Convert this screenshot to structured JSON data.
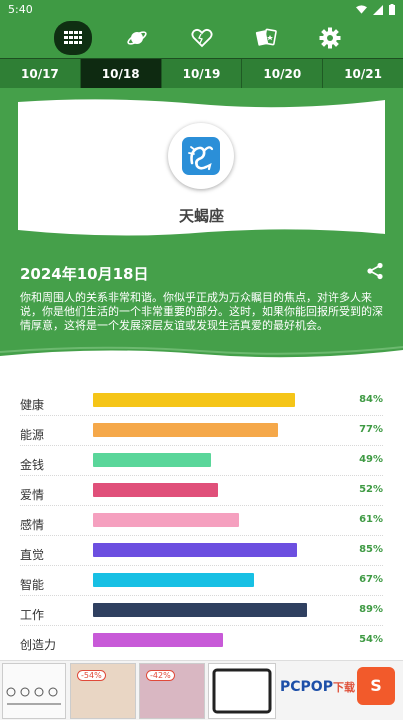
{
  "status": {
    "time": "5:40"
  },
  "nav": {
    "icons": [
      "grid-icon",
      "planet-icon",
      "heart-icon",
      "cards-icon",
      "gear-icon"
    ],
    "active_index": 0
  },
  "date_tabs": [
    "10/17",
    "10/18",
    "10/19",
    "10/20",
    "10/21"
  ],
  "selected_tab": 1,
  "sign": {
    "name": "天蝎座",
    "icon": "scorpio-icon"
  },
  "reading": {
    "date_title": "2024年10月18日",
    "text": "你和周围人的关系非常和谐。你似乎正成为万众瞩目的焦点，对许多人来说，你是他们生活的一个非常重要的部分。这时，如果你能回报所受到的深情厚意，这将是一个发展深层友谊或发现生活真爱的最好机会。"
  },
  "scores": [
    {
      "label": "健康",
      "value": 84,
      "pct": "84%",
      "color": "#f5c518"
    },
    {
      "label": "能源",
      "value": 77,
      "pct": "77%",
      "color": "#f5a84a"
    },
    {
      "label": "金钱",
      "value": 49,
      "pct": "49%",
      "color": "#5ad69a"
    },
    {
      "label": "爱情",
      "value": 52,
      "pct": "52%",
      "color": "#e0507a"
    },
    {
      "label": "感情",
      "value": 61,
      "pct": "61%",
      "color": "#f5a0bf"
    },
    {
      "label": "直觉",
      "value": 85,
      "pct": "85%",
      "color": "#6c4fe0"
    },
    {
      "label": "智能",
      "value": 67,
      "pct": "67%",
      "color": "#18c0e4"
    },
    {
      "label": "工作",
      "value": 89,
      "pct": "89%",
      "color": "#2f4060"
    },
    {
      "label": "创造力",
      "value": 54,
      "pct": "54%",
      "color": "#c85ad8"
    }
  ],
  "ad": {
    "discount1": "-54%",
    "discount2": "-42%",
    "brand": "PCPOP",
    "brand_suffix": "下载"
  },
  "colors": {
    "primary": "#3f9a44",
    "dark": "#0e2a11",
    "accent_text": "#3f9a44"
  }
}
